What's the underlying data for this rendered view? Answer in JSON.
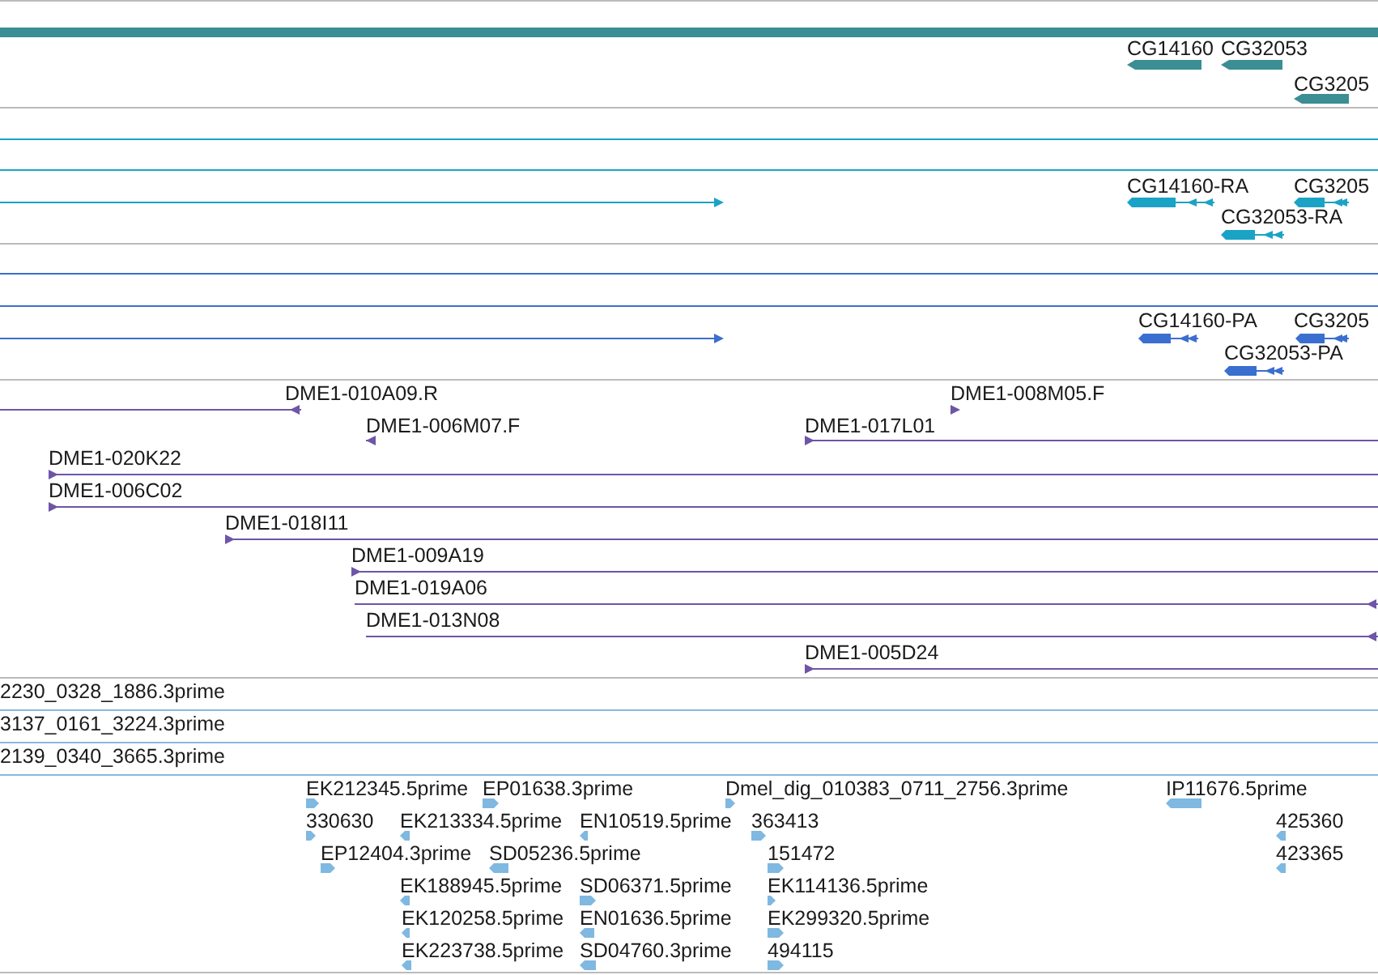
{
  "tracks": [
    {
      "color": "#3a8e94",
      "features": [
        {
          "kind": "bar"
        },
        {
          "kind": "gene",
          "label": "CG14160",
          "reverse": true
        },
        {
          "kind": "gene",
          "label": "CG32053",
          "reverse": true
        },
        {
          "kind": "gene",
          "label": "CG3205",
          "reverse": true
        }
      ]
    },
    {
      "color": "#1ba3c6",
      "features": [
        {
          "kind": "span"
        },
        {
          "kind": "span"
        },
        {
          "kind": "line",
          "reverse": false
        },
        {
          "kind": "transcript",
          "label": "CG14160-RA",
          "reverse": true
        },
        {
          "kind": "transcript",
          "label": "CG3205",
          "reverse": true
        },
        {
          "kind": "transcript",
          "label": "CG32053-RA",
          "reverse": true
        }
      ]
    },
    {
      "color": "#3a6fd0",
      "features": [
        {
          "kind": "span"
        },
        {
          "kind": "span"
        },
        {
          "kind": "line",
          "reverse": false
        },
        {
          "kind": "transcript",
          "label": "CG14160-PA",
          "reverse": true
        },
        {
          "kind": "transcript",
          "label": "CG3205",
          "reverse": true
        },
        {
          "kind": "transcript",
          "label": "CG32053-PA",
          "reverse": true
        }
      ]
    },
    {
      "color": "#6e55a8",
      "features": [
        {
          "kind": "clone",
          "label": "DME1-010A09.R",
          "reverse": true
        },
        {
          "kind": "clone",
          "label": "DME1-008M05.F",
          "reverse": false
        },
        {
          "kind": "clone",
          "label": "DME1-006M07.F",
          "reverse": true
        },
        {
          "kind": "clone",
          "label": "DME1-017L01",
          "reverse": false
        },
        {
          "kind": "clone",
          "label": "DME1-020K22",
          "reverse": false
        },
        {
          "kind": "clone",
          "label": "DME1-006C02",
          "reverse": false
        },
        {
          "kind": "clone",
          "label": "DME1-018I11",
          "reverse": false
        },
        {
          "kind": "clone",
          "label": "DME1-009A19",
          "reverse": false
        },
        {
          "kind": "clone",
          "label": "DME1-019A06",
          "reverse": true
        },
        {
          "kind": "clone",
          "label": "DME1-013N08",
          "reverse": true
        },
        {
          "kind": "clone",
          "label": "DME1-005D24",
          "reverse": false
        }
      ]
    },
    {
      "features": [
        {
          "kind": "label",
          "label": "2230_0328_1886.3prime"
        }
      ]
    },
    {
      "features": [
        {
          "kind": "label",
          "label": "3137_0161_3224.3prime"
        }
      ]
    },
    {
      "features": [
        {
          "kind": "label",
          "label": "2139_0340_3665.3prime"
        }
      ]
    },
    {
      "color": "#7fb8e0",
      "features": [
        {
          "kind": "est",
          "label": "EK212345.5prime",
          "reverse": false
        },
        {
          "kind": "est",
          "label": "EP01638.3prime",
          "reverse": false
        },
        {
          "kind": "est",
          "label": "Dmel_dig_010383_0711_2756.3prime",
          "reverse": false
        },
        {
          "kind": "est",
          "label": "IP11676.5prime",
          "reverse": true
        },
        {
          "kind": "est",
          "label": "330630",
          "reverse": false
        },
        {
          "kind": "est",
          "label": "EK213334.5prime",
          "reverse": true
        },
        {
          "kind": "est",
          "label": "EN10519.5prime",
          "reverse": true
        },
        {
          "kind": "est",
          "label": "363413",
          "reverse": false
        },
        {
          "kind": "est",
          "label": "425360",
          "reverse": true
        },
        {
          "kind": "est",
          "label": "EP12404.3prime",
          "reverse": false
        },
        {
          "kind": "est",
          "label": "SD05236.5prime",
          "reverse": true
        },
        {
          "kind": "est",
          "label": "151472",
          "reverse": false
        },
        {
          "kind": "est",
          "label": "423365",
          "reverse": true
        },
        {
          "kind": "est",
          "label": "EK188945.5prime",
          "reverse": true
        },
        {
          "kind": "est",
          "label": "SD06371.5prime",
          "reverse": false
        },
        {
          "kind": "est",
          "label": "EK114136.5prime",
          "reverse": false
        },
        {
          "kind": "est",
          "label": "EK120258.5prime",
          "reverse": true
        },
        {
          "kind": "est",
          "label": "EN01636.5prime",
          "reverse": true
        },
        {
          "kind": "est",
          "label": "EK299320.5prime",
          "reverse": false
        },
        {
          "kind": "est",
          "label": "EK223738.5prime",
          "reverse": true
        },
        {
          "kind": "est",
          "label": "SD04760.3prime",
          "reverse": true
        },
        {
          "kind": "est",
          "label": "494115",
          "reverse": false
        }
      ]
    }
  ]
}
